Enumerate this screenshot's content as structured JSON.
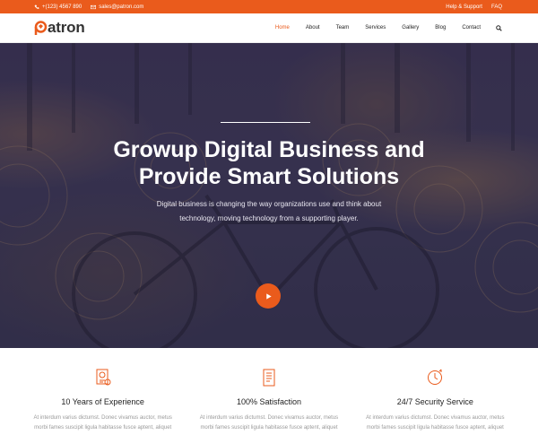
{
  "topbar": {
    "phone": "+(123) 4567 890",
    "email": "sales@patron.com",
    "help": "Help & Support",
    "faq": "FAQ"
  },
  "nav": {
    "logo_text": "atron",
    "items": [
      {
        "label": "Home",
        "active": true
      },
      {
        "label": "About"
      },
      {
        "label": "Team"
      },
      {
        "label": "Services"
      },
      {
        "label": "Gallery"
      },
      {
        "label": "Blog"
      },
      {
        "label": "Contact"
      }
    ]
  },
  "hero": {
    "title_line1": "Growup Digital Business and",
    "title_line2": "Provide Smart Solutions",
    "text_line1": "Digital business is changing the way organizations use and think about",
    "text_line2": "technology, moving technology from a supporting player."
  },
  "features": [
    {
      "icon": "certificate-icon",
      "title": "10 Years of Experience",
      "line1": "At interdum varius dictumst. Donec vivamus auctor, metus",
      "line2": "morbi fames suscipit ligula habitasse fusce aptent, aliquet"
    },
    {
      "icon": "document-icon",
      "title": "100% Satisfaction",
      "line1": "At interdum varius dictumst. Donec vivamus auctor, metus",
      "line2": "morbi fames suscipit ligula habitasse fusce aptent, aliquet"
    },
    {
      "icon": "clock-24-icon",
      "title": "24/7 Security Service",
      "line1": "At interdum varius dictumst. Donec vivamus auctor, metus",
      "line2": "morbi fames suscipit ligula habitasse fusce aptent, aliquet"
    }
  ],
  "colors": {
    "accent": "#ea5b1c",
    "hero_overlay": "#3a3150"
  }
}
